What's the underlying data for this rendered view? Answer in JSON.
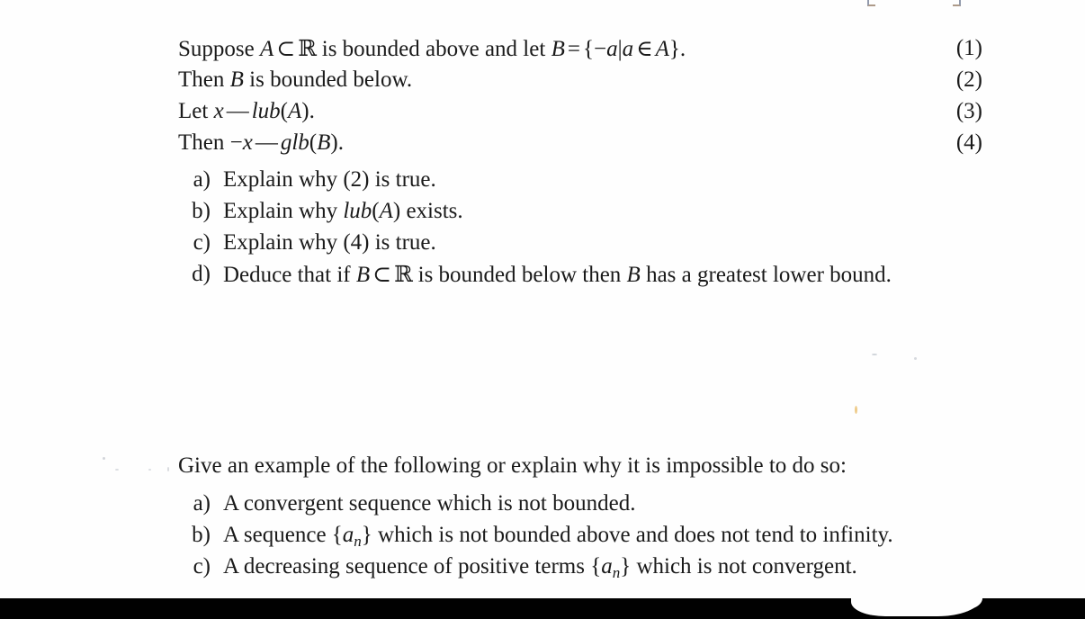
{
  "document": {
    "type": "scanned-math-worksheet",
    "background_color": "#fefefe",
    "text_color": "#1a1a1a",
    "band_color": "#010101"
  },
  "problem_one": {
    "statements": [
      {
        "number": "(1)",
        "parts": [
          {
            "kind": "text",
            "value": "Suppose "
          },
          {
            "kind": "math-italic",
            "value": "A"
          },
          {
            "kind": "op",
            "value": "⊂"
          },
          {
            "kind": "blackboard",
            "value": "ℝ"
          },
          {
            "kind": "text",
            "value": " is bounded above and let "
          },
          {
            "kind": "math-italic",
            "value": "B"
          },
          {
            "kind": "op",
            "value": "="
          },
          {
            "kind": "text",
            "value": "{"
          },
          {
            "kind": "text",
            "value": "−"
          },
          {
            "kind": "math-italic",
            "value": "a"
          },
          {
            "kind": "text",
            "value": "|"
          },
          {
            "kind": "math-italic",
            "value": "a"
          },
          {
            "kind": "op",
            "value": "∈"
          },
          {
            "kind": "math-italic",
            "value": "A"
          },
          {
            "kind": "text",
            "value": "}."
          }
        ],
        "plain": "Suppose A ⊂ ℝ is bounded above and let B = {−a|a ∈ A}."
      },
      {
        "number": "(2)",
        "parts": [
          {
            "kind": "text",
            "value": "Then "
          },
          {
            "kind": "math-italic",
            "value": "B"
          },
          {
            "kind": "text",
            "value": " is bounded below."
          }
        ],
        "plain": "Then B is bounded below."
      },
      {
        "number": "(3)",
        "parts": [
          {
            "kind": "text",
            "value": "Let "
          },
          {
            "kind": "math-italic",
            "value": "x"
          },
          {
            "kind": "op",
            "value": "—"
          },
          {
            "kind": "math-italic",
            "value": "lub"
          },
          {
            "kind": "text",
            "value": "("
          },
          {
            "kind": "math-italic",
            "value": "A"
          },
          {
            "kind": "text",
            "value": ")."
          }
        ],
        "plain": "Let x — lub(A)."
      },
      {
        "number": "(4)",
        "parts": [
          {
            "kind": "text",
            "value": "Then "
          },
          {
            "kind": "text",
            "value": "−"
          },
          {
            "kind": "math-italic",
            "value": "x"
          },
          {
            "kind": "op",
            "value": "—"
          },
          {
            "kind": "math-italic",
            "value": "glb"
          },
          {
            "kind": "text",
            "value": "("
          },
          {
            "kind": "math-italic",
            "value": "B"
          },
          {
            "kind": "text",
            "value": ")."
          }
        ],
        "plain": "Then −x — glb(B)."
      }
    ],
    "items": [
      {
        "label": "a)",
        "parts": [
          {
            "kind": "text",
            "value": "Explain why (2) is true."
          }
        ],
        "plain": "Explain why (2) is true."
      },
      {
        "label": "b)",
        "parts": [
          {
            "kind": "text",
            "value": "Explain why "
          },
          {
            "kind": "math-italic",
            "value": "lub"
          },
          {
            "kind": "text",
            "value": "("
          },
          {
            "kind": "math-italic",
            "value": "A"
          },
          {
            "kind": "text",
            "value": ") exists."
          }
        ],
        "plain": "Explain why lub(A) exists."
      },
      {
        "label": "c)",
        "parts": [
          {
            "kind": "text",
            "value": "Explain why (4) is true."
          }
        ],
        "plain": "Explain why (4) is true."
      },
      {
        "label": "d)",
        "parts": [
          {
            "kind": "text",
            "value": "Deduce that if "
          },
          {
            "kind": "math-italic",
            "value": "B"
          },
          {
            "kind": "op",
            "value": "⊂"
          },
          {
            "kind": "blackboard",
            "value": "ℝ"
          },
          {
            "kind": "text",
            "value": " is bounded below then "
          },
          {
            "kind": "math-italic",
            "value": "B"
          },
          {
            "kind": "text",
            "value": " has a greatest lower bound."
          }
        ],
        "plain": "Deduce that if B ⊂ ℝ is bounded below then B has a greatest lower bound."
      }
    ]
  },
  "problem_two": {
    "prompt": "Give an example of the following or explain why it is impossible to do so:",
    "items": [
      {
        "label": "a)",
        "parts": [
          {
            "kind": "text",
            "value": "A convergent sequence which is not bounded."
          }
        ],
        "plain": "A convergent sequence which is not bounded."
      },
      {
        "label": "b)",
        "parts": [
          {
            "kind": "text",
            "value": "A sequence {"
          },
          {
            "kind": "math-sub",
            "base": "a",
            "sub": "n"
          },
          {
            "kind": "text",
            "value": "} which is not bounded above and does not tend to infinity."
          }
        ],
        "plain": "A sequence {aₙ} which is not bounded above and does not tend to infinity."
      },
      {
        "label": "c)",
        "parts": [
          {
            "kind": "text",
            "value": "A decreasing sequence of positive terms {"
          },
          {
            "kind": "math-sub",
            "base": "a",
            "sub": "n"
          },
          {
            "kind": "text",
            "value": "} which is not convergent."
          }
        ],
        "plain": "A decreasing sequence of positive terms {aₙ} which is not convergent."
      }
    ]
  }
}
